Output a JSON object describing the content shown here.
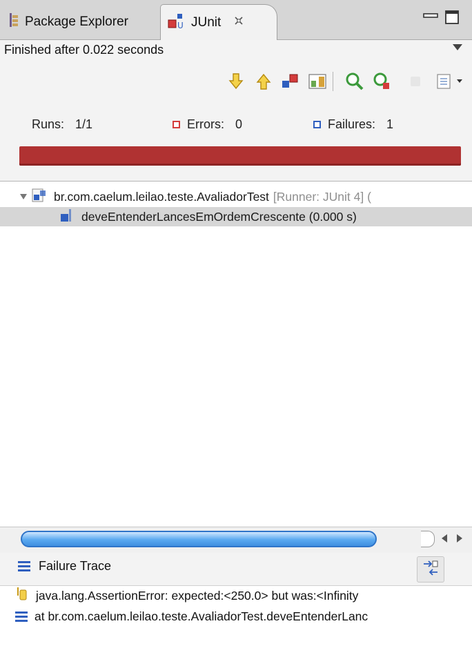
{
  "tabs": {
    "package_explorer": "Package Explorer",
    "junit": "JUnit"
  },
  "status_text": "Finished after 0.022 seconds",
  "counters": {
    "runs_label": "Runs:",
    "runs_value": "1/1",
    "errors_label": "Errors:",
    "errors_value": "0",
    "failures_label": "Failures:",
    "failures_value": "1"
  },
  "progress": {
    "fraction": 1.0,
    "color": "#b03232"
  },
  "tree": {
    "suite_name": "br.com.caelum.leilao.teste.AvaliadorTest",
    "suite_runner": "[Runner: JUnit 4] (",
    "test_name": "deveEntenderLancesEmOrdemCrescente (0.000 s)"
  },
  "failure_trace": {
    "title": "Failure Trace",
    "line1": "java.lang.AssertionError: expected:<250.0> but was:<Infinity",
    "line2": "at br.com.caelum.leilao.teste.AvaliadorTest.deveEntenderLanc"
  },
  "icons": {
    "package_explorer": "package-icon",
    "junit": "junit-icon",
    "close_tab": "close-icon",
    "minimize": "minimize-icon",
    "maximize": "maximize-icon",
    "view_menu": "chevron-down-icon",
    "next_failure": "arrow-down-icon",
    "previous_failure": "arrow-up-icon",
    "show_failures_only": "failures-filter-icon",
    "scroll_lock": "scroll-lock-icon",
    "rerun": "rerun-icon",
    "rerun_failed_first": "rerun-failed-icon",
    "stop": "stop-icon",
    "history": "history-icon",
    "compare": "compare-icon"
  },
  "colors": {
    "failure_bar": "#b03232",
    "error_marker": "#d43c3c",
    "failure_marker": "#2f5fbf",
    "selection": "#d6d6d6"
  }
}
